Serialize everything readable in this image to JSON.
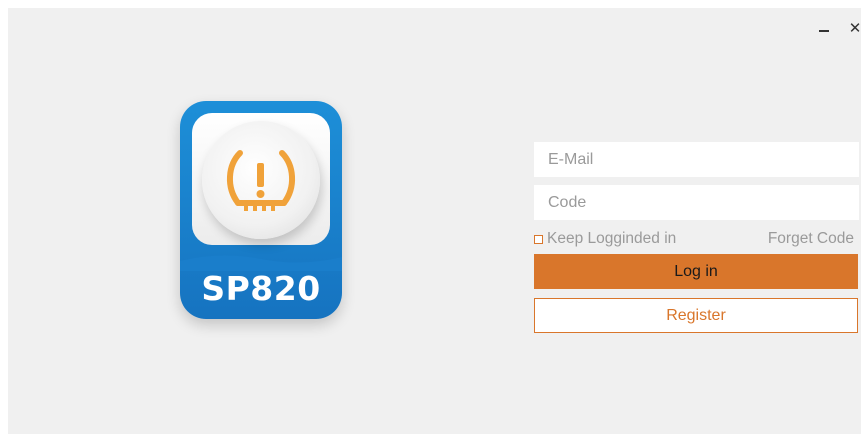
{
  "window": {
    "minimize_label": "Minimize",
    "close_label": "Close"
  },
  "app_icon": {
    "brand_text": "SP820",
    "icon": "tpms-warning-icon",
    "colors": {
      "blue": "#1a82cf",
      "orange": "#f0a23a"
    }
  },
  "login": {
    "email_placeholder": "E-Mail",
    "email_value": "",
    "code_placeholder": "Code",
    "code_value": "",
    "keep_logged_in_label": "Keep Logginded in",
    "forget_code_label": "Forget Code",
    "login_button_label": "Log in",
    "register_button_label": "Register",
    "accent_color": "#d9762b"
  }
}
